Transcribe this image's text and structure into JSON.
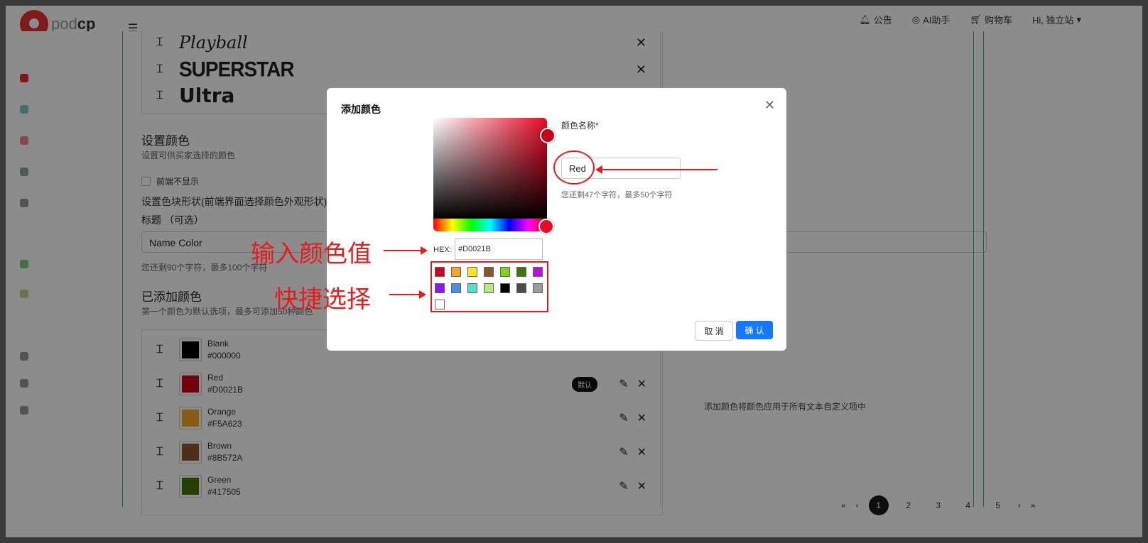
{
  "app": {
    "logo_text_light": "pod",
    "logo_text_bold": "cp"
  },
  "topnav": {
    "announcement": "公告",
    "ai": "AI助手",
    "cart": "购物车",
    "greeting": "Hi, 独立站"
  },
  "fonts": [
    {
      "name": "Playball"
    },
    {
      "name": "SUPERSTAR"
    },
    {
      "name": "Ultra"
    }
  ],
  "settings": {
    "color_title": "设置颜色",
    "color_sub": "设置可供买家选择的颜色",
    "hide_frontend": "前端不显示",
    "shape_label": "设置色块形状(前端界面选择颜色外观形状):",
    "title_label": "标题 （可选）",
    "title_value": "Name Color",
    "title_hint": "您还剩90个字符，最多100个字符",
    "added_title": "已添加颜色",
    "added_sub": "第一个颜色为默认选项，最多可添加50种颜色",
    "right_note": "添加颜色将颜色应用于所有文本自定义项中"
  },
  "colors": [
    {
      "name": "Blank",
      "hex": "#000000",
      "swatch": "#000000"
    },
    {
      "name": "Red",
      "hex": "#D0021B",
      "swatch": "#D0021B",
      "badge": "默认"
    },
    {
      "name": "Orange",
      "hex": "#F5A623",
      "swatch": "#F5A623"
    },
    {
      "name": "Brown",
      "hex": "#8B572A",
      "swatch": "#8B572A"
    },
    {
      "name": "Green",
      "hex": "#417505",
      "swatch": "#417505"
    }
  ],
  "pagination": {
    "pages": [
      "1",
      "2",
      "3",
      "4",
      "5"
    ],
    "active": "1"
  },
  "modal": {
    "title": "添加颜色",
    "hex_label": "HEX:",
    "hex_value": "#D0021B",
    "name_label": "颜色名称*",
    "name_value": "Red",
    "name_hint": "您还剩47个字符，最多50个字符",
    "cancel": "取 消",
    "confirm": "确 认",
    "presets": [
      "#D0021B",
      "#F5A623",
      "#F8E71C",
      "#8B572A",
      "#7ED321",
      "#417505",
      "#BD10E0",
      "#9013FE",
      "#4A90E2",
      "#50E3C2",
      "#B8E986",
      "#000000",
      "#4A4A4A",
      "#9B9B9B",
      "#FFFFFF"
    ]
  },
  "annotations": {
    "hex_note": "输入颜色值",
    "preset_note": "快捷选择"
  }
}
